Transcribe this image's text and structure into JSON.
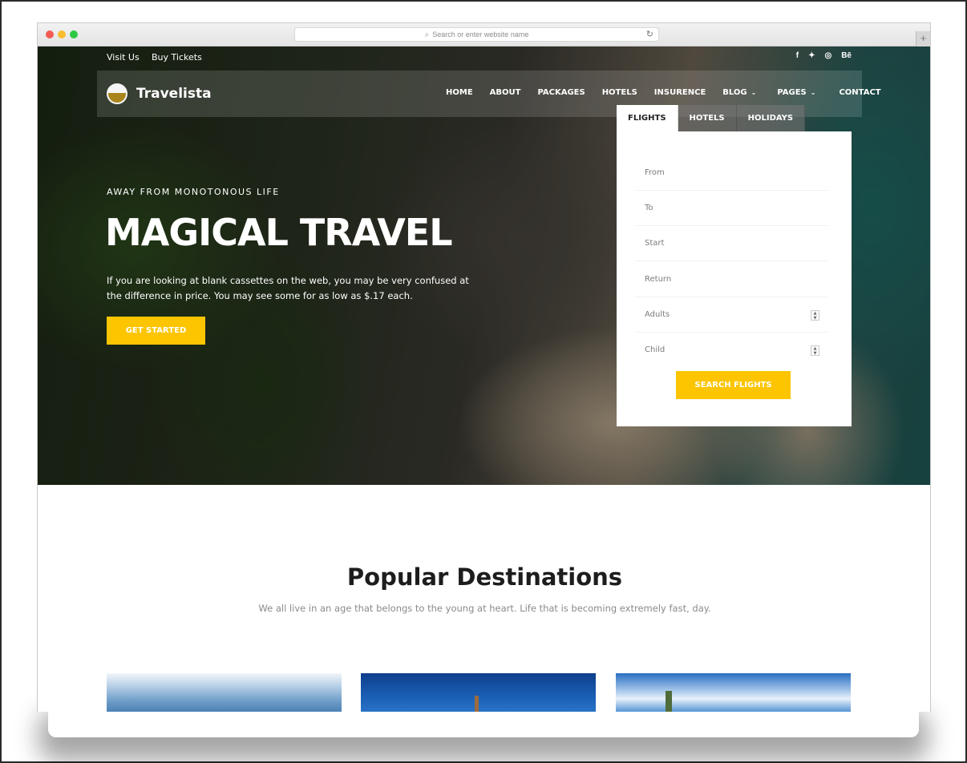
{
  "browser": {
    "address_placeholder": "Search or enter website name",
    "icons": {
      "search": "search-icon",
      "reload": "reload-icon",
      "new_tab": "plus-icon"
    },
    "new_tab_glyph": "+"
  },
  "topbar": {
    "links": [
      "Visit Us",
      "Buy Tickets"
    ],
    "social": [
      {
        "name": "facebook-icon",
        "glyph": "f"
      },
      {
        "name": "twitter-icon",
        "glyph": "🐦"
      },
      {
        "name": "dribbble-icon",
        "glyph": "◎"
      },
      {
        "name": "behance-icon",
        "glyph": "Bē"
      }
    ]
  },
  "brand": {
    "name": "Travelista"
  },
  "nav": {
    "items": [
      {
        "label": "HOME"
      },
      {
        "label": "ABOUT"
      },
      {
        "label": "PACKAGES"
      },
      {
        "label": "HOTELS"
      },
      {
        "label": "INSURENCE"
      },
      {
        "label": "BLOG",
        "dropdown": true
      },
      {
        "label": "PAGES",
        "dropdown": true
      },
      {
        "label": "CONTACT"
      }
    ],
    "chevron": "⌄"
  },
  "hero": {
    "eyebrow": "AWAY FROM MONOTONOUS LIFE",
    "title": "MAGICAL TRAVEL",
    "description": "If you are looking at blank cassettes on the web, you may be very confused at the difference in price. You may see some for as low as $.17 each.",
    "cta_label": "GET STARTED"
  },
  "booking": {
    "tabs": [
      {
        "label": "FLIGHTS",
        "active": true
      },
      {
        "label": "HOTELS",
        "active": false
      },
      {
        "label": "HOLIDAYS",
        "active": false
      }
    ],
    "fields": [
      {
        "placeholder": "From"
      },
      {
        "placeholder": "To"
      },
      {
        "placeholder": "Start"
      },
      {
        "placeholder": "Return"
      },
      {
        "placeholder": "Adults",
        "stepper": true
      },
      {
        "placeholder": "Child",
        "stepper": true
      }
    ],
    "submit_label": "SEARCH FLIGHTS"
  },
  "destinations": {
    "title": "Popular Destinations",
    "subtitle": "We all live in an age that belongs to the young at heart. Life that is becoming extremely fast, day.",
    "cards": [
      {
        "name": "mountain-lake"
      },
      {
        "name": "city-tower"
      },
      {
        "name": "traveler-sky"
      }
    ]
  },
  "colors": {
    "accent": "#fcc500",
    "heading": "#1d1d1d",
    "muted": "#8a8a8a"
  }
}
